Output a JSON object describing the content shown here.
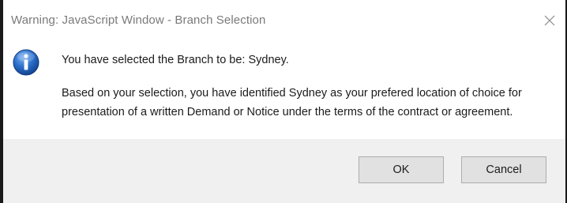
{
  "window": {
    "title": "Warning: JavaScript Window - Branch Selection",
    "close_icon": "close-icon"
  },
  "dialog": {
    "icon": "info-icon",
    "line1": "You have selected the Branch to be: Sydney.",
    "line2": "Based on your selection, you have identified Sydney as your prefered location of choice for",
    "line3": "presentation of a written Demand or Notice under the terms of the contract or agreement."
  },
  "buttons": {
    "ok_label": "OK",
    "cancel_label": "Cancel"
  },
  "colors": {
    "title_text": "#7a7a7a",
    "footer_bg": "#f0f0f0",
    "button_bg": "#e1e1e1",
    "info_icon_blue": "#1f5fb5"
  }
}
